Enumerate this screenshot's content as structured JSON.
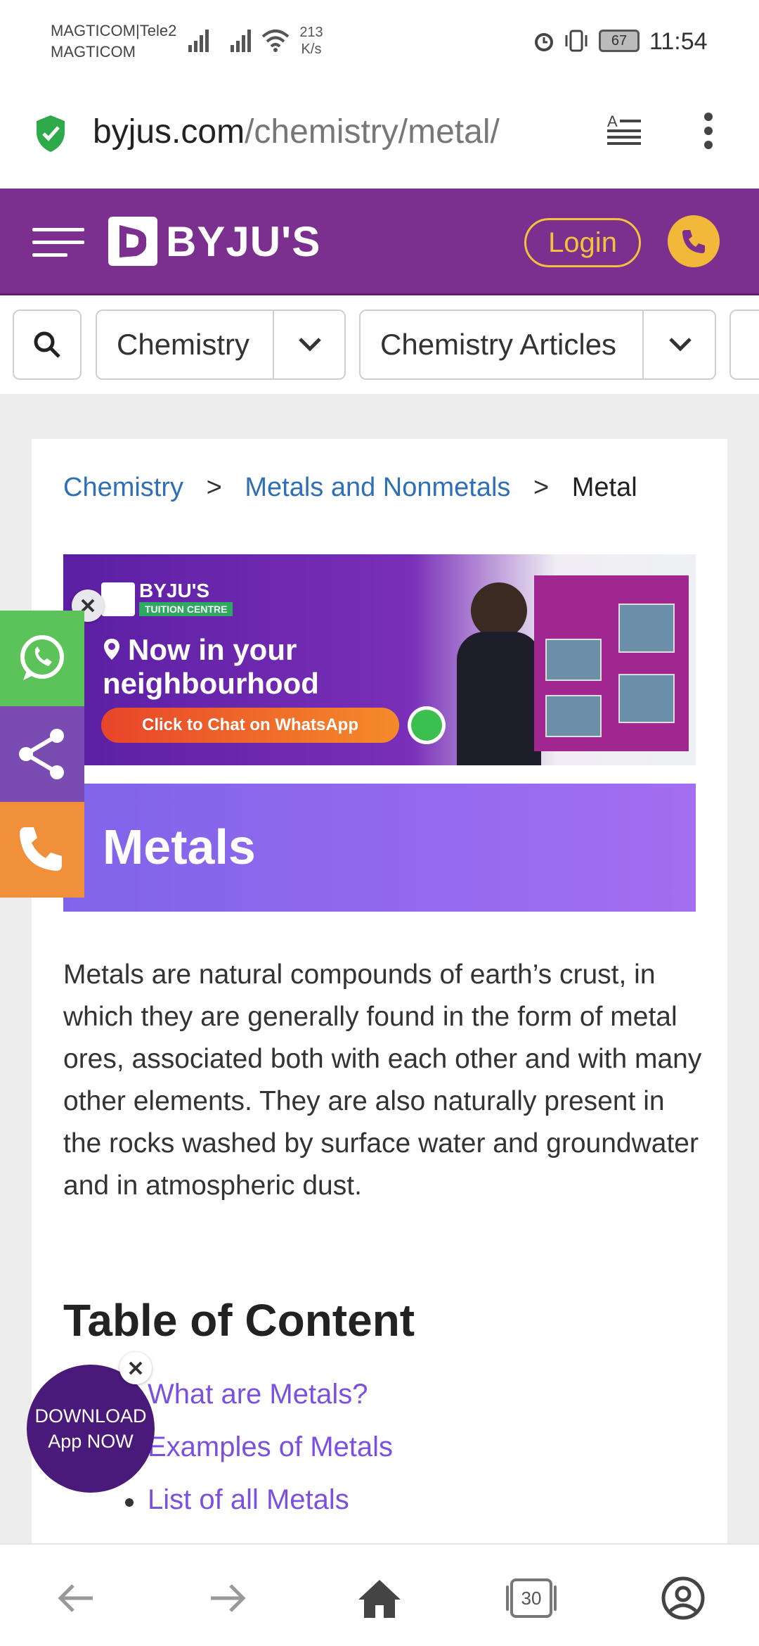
{
  "status_bar": {
    "carrier_1": "MAGTICOM|Tele2",
    "carrier_2": "MAGTICOM",
    "speed_value": "213",
    "speed_unit": "K/s",
    "battery": "67",
    "time": "11:54"
  },
  "address_bar": {
    "domain": "byjus.com",
    "path": "/chemistry/metal/"
  },
  "header": {
    "brand": "BYJU'S",
    "login_label": "Login"
  },
  "nav": {
    "dropdowns": [
      {
        "label": "Chemistry"
      },
      {
        "label": "Chemistry Articles"
      }
    ]
  },
  "breadcrumb": {
    "items": [
      "Chemistry",
      "Metals and Nonmetals",
      "Metal"
    ],
    "separator": ">"
  },
  "promo": {
    "brand": "BYJU'S",
    "sub_brand": "TUITION CENTRE",
    "headline_1": "Now in your",
    "headline_2": "neighbourhood",
    "cta": "Click to Chat on WhatsApp"
  },
  "article": {
    "title": "Metals",
    "intro": "Metals are natural compounds of earth’s crust, in which they are generally found in the form of metal ores, associated both with each other and with many other elements. They are also naturally present in the rocks washed by surface water and groundwater and in atmospheric dust."
  },
  "toc": {
    "heading": "Table of Content",
    "items": [
      "What are Metals?",
      "Examples of Metals",
      "List of all Metals"
    ]
  },
  "download": {
    "line_1": "DOWNLOAD",
    "line_2": "App NOW"
  },
  "bottom_nav": {
    "tab_count": "30"
  },
  "colors": {
    "header_purple": "#7b2f8e",
    "accent_yellow": "#f2c23c",
    "link_blue": "#2f6fb5",
    "toc_purple": "#7b4fe0",
    "whatsapp_green": "#5cc35a",
    "share_purple": "#7a4bb0",
    "call_orange": "#f0903a"
  }
}
